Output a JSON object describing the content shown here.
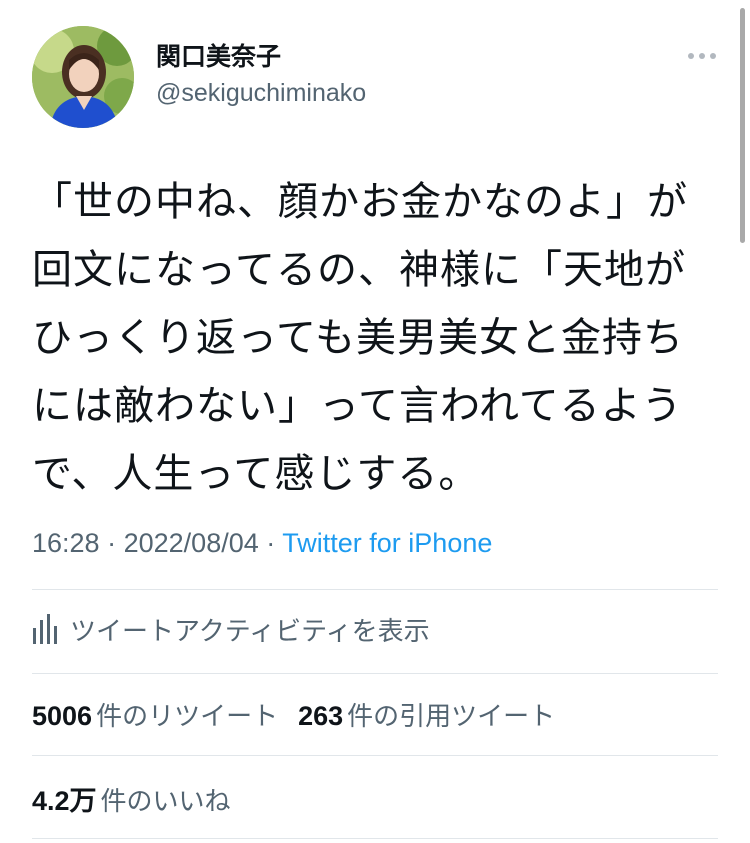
{
  "user": {
    "display_name": "関口美奈子",
    "handle": "@sekiguchiminako"
  },
  "tweet": {
    "lines": [
      "「世の中ね、顔かお金かなのよ」が",
      "回文になってるの、神様に「天地が",
      "ひっくり返っても美男美女と金持ち",
      "には敵わない」って言われてるよう",
      "で、人生って感じする。"
    ]
  },
  "meta": {
    "time": "16:28",
    "separator": "·",
    "date": "2022/08/04",
    "source": "Twitter for iPhone"
  },
  "activity": {
    "label": "ツイートアクティビティを表示",
    "icon": "bar-chart-icon"
  },
  "stats": {
    "retweets_count": "5006",
    "retweets_label": "件のリツイート",
    "quotes_count": "263",
    "quotes_label": "件の引用ツイート",
    "likes_count": "4.2万",
    "likes_label": "件のいいね"
  },
  "colors": {
    "text": "#0f1419",
    "secondary": "#536471",
    "link": "#1d9bf0",
    "divider": "#e1e6ea"
  }
}
